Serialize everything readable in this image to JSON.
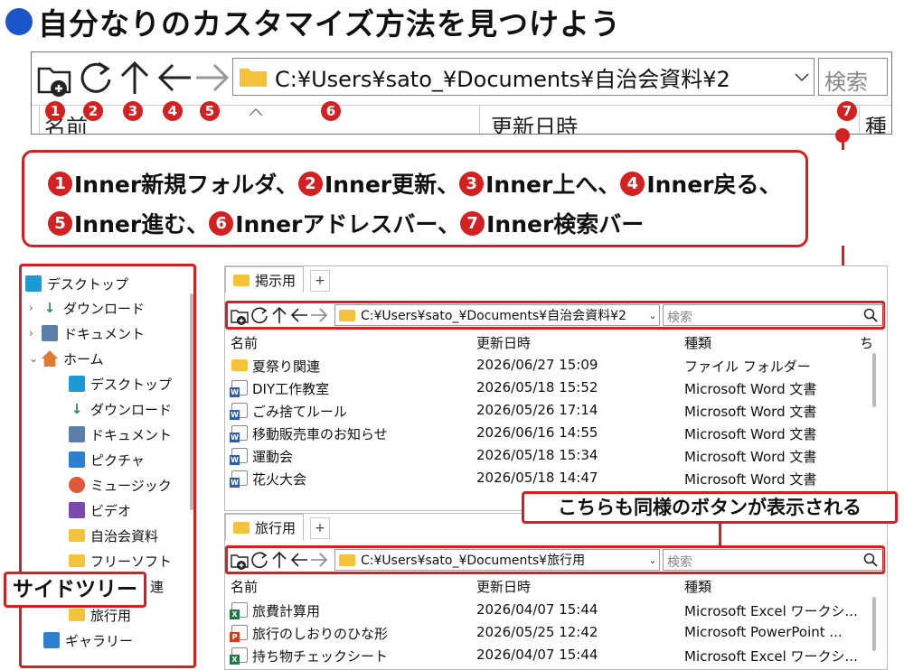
{
  "heading": {
    "text": "自分なりのカスタマイズ方法を見つけよう"
  },
  "zoom_toolbar": {
    "address": "C:¥Users¥sato_¥Documents¥自治会資料¥2",
    "search_placeholder": "検索",
    "columns": {
      "name": "名前",
      "modified": "更新日時",
      "type": "種"
    },
    "numbers": [
      "1",
      "2",
      "3",
      "4",
      "5",
      "6",
      "7"
    ]
  },
  "callout": {
    "line1": [
      {
        "num": "1",
        "text": "Inner新規フォルダ、"
      },
      {
        "num": "2",
        "text": "Inner更新、"
      },
      {
        "num": "3",
        "text": "Inner上へ、"
      },
      {
        "num": "4",
        "text": "Inner戻る、"
      }
    ],
    "line2": [
      {
        "num": "5",
        "text": "Inner進む、"
      },
      {
        "num": "6",
        "text": "Innerアドレスバー、"
      },
      {
        "num": "7",
        "text": "Inner検索バー"
      }
    ]
  },
  "sidebar": {
    "label": "サイドツリー",
    "items": [
      {
        "label": "デスクトップ",
        "icon": "desktop-icon",
        "color": "#1b9ad6"
      },
      {
        "label": "ダウンロード",
        "icon": "download-icon",
        "color": "#2e8b57"
      },
      {
        "label": "ドキュメント",
        "icon": "document-icon",
        "color": "#5b7fa8"
      },
      {
        "label": "ホーム",
        "icon": "home-icon",
        "color": "#e07a30"
      },
      {
        "label": "デスクトップ",
        "icon": "desktop-icon",
        "color": "#1b9ad6"
      },
      {
        "label": "ダウンロード",
        "icon": "download-icon",
        "color": "#2e8b57"
      },
      {
        "label": "ドキュメント",
        "icon": "document-icon",
        "color": "#5b7fa8"
      },
      {
        "label": "ピクチャ",
        "icon": "picture-icon",
        "color": "#2d7fd1"
      },
      {
        "label": "ミュージック",
        "icon": "music-icon",
        "color": "#e0573a"
      },
      {
        "label": "ビデオ",
        "icon": "video-icon",
        "color": "#7a4ab0"
      },
      {
        "label": "自治会資料",
        "icon": "folder-icon",
        "color": "#f5c33b"
      },
      {
        "label": "フリーソフト",
        "icon": "folder-icon",
        "color": "#f5c33b"
      },
      {
        "label": "連",
        "icon": "folder-icon",
        "color": "#f5c33b"
      },
      {
        "label": "旅行用",
        "icon": "folder-icon",
        "color": "#f5c33b"
      },
      {
        "label": "ギャラリー",
        "icon": "gallery-icon",
        "color": "#2d7fd1"
      }
    ]
  },
  "pane_top": {
    "tab_label": "掲示用",
    "tab_plus": "+",
    "address": "C:¥Users¥sato_¥Documents¥自治会資料¥2",
    "search_placeholder": "検索",
    "columns": {
      "name": "名前",
      "modified": "更新日時",
      "type": "種類",
      "size": "ち"
    },
    "rows": [
      {
        "name": "夏祭り関連",
        "modified": "2026/06/27 15:09",
        "type": "ファイル フォルダー",
        "icon": "folder-icon"
      },
      {
        "name": "DIY工作教室",
        "modified": "2026/05/18 15:52",
        "type": "Microsoft Word 文書",
        "icon": "word-icon"
      },
      {
        "name": "ごみ捨てルール",
        "modified": "2026/05/26 17:14",
        "type": "Microsoft Word 文書",
        "icon": "word-icon"
      },
      {
        "name": "移動販売車のお知らせ",
        "modified": "2026/06/16 14:55",
        "type": "Microsoft Word 文書",
        "icon": "word-icon"
      },
      {
        "name": "運動会",
        "modified": "2026/05/18 15:34",
        "type": "Microsoft Word 文書",
        "icon": "word-icon"
      },
      {
        "name": "花火大会",
        "modified": "2026/05/18 14:47",
        "type": "Microsoft Word 文書",
        "icon": "word-icon"
      }
    ]
  },
  "pane_bottom": {
    "tab_label": "旅行用",
    "tab_plus": "+",
    "note": "こちらも同様のボタンが表示される",
    "address": "C:¥Users¥sato_¥Documents¥旅行用",
    "search_placeholder": "検索",
    "columns": {
      "name": "名前",
      "modified": "更新日時",
      "type": "種類"
    },
    "rows": [
      {
        "name": "旅費計算用",
        "modified": "2026/04/07 15:44",
        "type": "Microsoft Excel ワークシ...",
        "icon": "excel-icon"
      },
      {
        "name": "旅行のしおりのひな形",
        "modified": "2026/05/25 12:42",
        "type": "Microsoft PowerPoint ...",
        "icon": "powerpoint-icon"
      },
      {
        "name": "持ち物チェックシート",
        "modified": "2026/04/07 15:44",
        "type": "Microsoft Excel ワークシ...",
        "icon": "excel-icon"
      }
    ]
  }
}
